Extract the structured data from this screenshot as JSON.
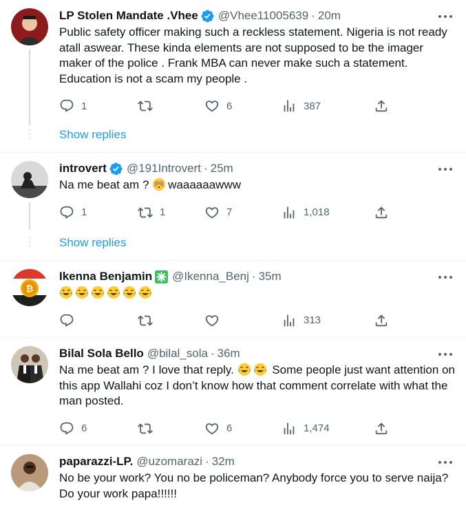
{
  "colors": {
    "link": "#1d9bf0",
    "verified": "#1d9bf0",
    "muted": "#536471",
    "text": "#0f1419"
  },
  "show_replies_label": "Show replies",
  "tweets": [
    {
      "name": "LP Stolen Mandate .Vhee",
      "badge": "verified-icon",
      "handle": "@Vhee11005639",
      "time": "20m",
      "text": "Public safety officer making such a reckless statement.  Nigeria is not ready atall aswear. These kinda elements are not supposed to be the imager maker of the police . Frank MBA can never make such a statement. Education is not a scam my people .",
      "replies": "1",
      "retweets": "",
      "likes": "6",
      "views": "387"
    },
    {
      "name": "introvert",
      "badge": "verified-icon",
      "handle": "@191Introvert",
      "time": "25m",
      "text": "Na me beat am ?",
      "text_after": "waaaaaawww",
      "replies": "1",
      "retweets": "1",
      "likes": "7",
      "views": "1,018"
    },
    {
      "name": "Ikenna Benjamin",
      "badge": "sparkle-icon",
      "handle": "@Ikenna_Benj",
      "time": "35m",
      "emoji": "laughing-crying-emoji-x6",
      "replies": "",
      "retweets": "",
      "likes": "",
      "views": "313"
    },
    {
      "name": "Bilal Sola Bello",
      "handle": "@bilal_sola",
      "time": "36m",
      "text_before": "Na me beat am ? I love that reply.",
      "text": "Some people just want attention on this app Wallahi coz I don’t know how that comment correlate with what the man posted.",
      "replies": "6",
      "retweets": "",
      "likes": "6",
      "views": "1,474"
    },
    {
      "name": "paparazzi-LP.",
      "handle": "@uzomarazi",
      "time": "32m",
      "text": "No be your work? You no be policeman? Anybody force you to serve naija? Do your work papa!!!!!!"
    }
  ],
  "separator": "·"
}
